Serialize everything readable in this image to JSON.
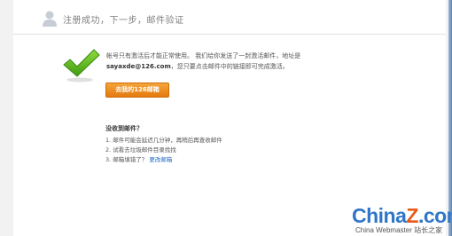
{
  "header": {
    "title": "注册成功，下一步，邮件验证",
    "icon": "user-icon"
  },
  "main": {
    "icon": "checkmark-icon",
    "line1": "帐号只有激活后才能正常使用。   我们给你发送了一封激活邮件，地址是",
    "email": "sayaxde@126.com",
    "line2_suffix": "，您只要点击邮件中的链接即可完成激活。",
    "button_label": "去我的126邮箱",
    "accent_color": "#e37a0f"
  },
  "faq": {
    "title": "没收到邮件？",
    "items": [
      "1. 邮件可能会延迟几分钟，再稍后再查收邮件",
      "2. 试看去垃圾邮件目录找找",
      "3. 邮箱填错了？"
    ],
    "change_link": "更改邮箱",
    "link_color": "#1e68c6"
  },
  "watermark": {
    "logo_prefix": "China",
    "logo_z": "Z",
    "logo_suffix": ".com",
    "subtitle": "China Webmaster 站长之家"
  }
}
